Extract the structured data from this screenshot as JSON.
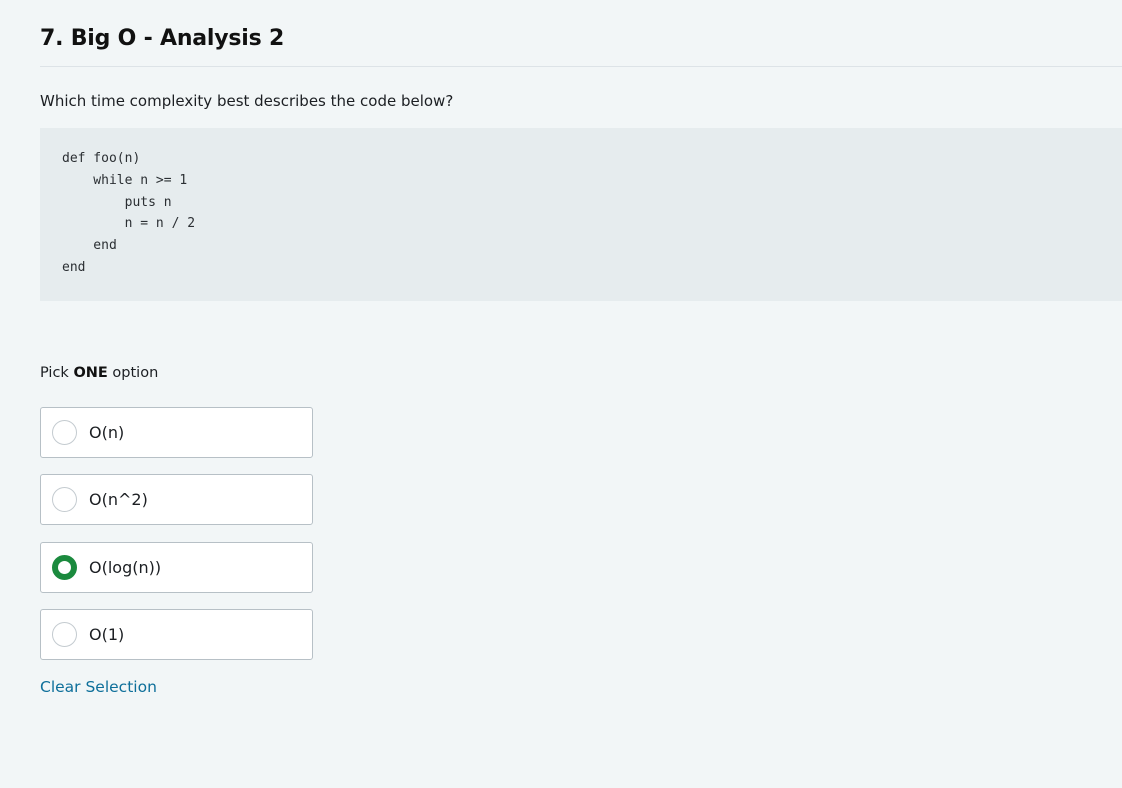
{
  "question": {
    "title": "7. Big O - Analysis 2",
    "prompt": "Which time complexity best describes the code below?"
  },
  "code": {
    "lines": [
      "def foo(n)",
      "    while n >= 1",
      "        puts n",
      "        n = n / 2",
      "    end",
      "end"
    ]
  },
  "pick": {
    "prefix": "Pick ",
    "emphasis": "ONE",
    "suffix": " option"
  },
  "options": [
    {
      "label": "O(n)",
      "selected": false
    },
    {
      "label": "O(n^2)",
      "selected": false
    },
    {
      "label": "O(log(n))",
      "selected": true
    },
    {
      "label": "O(1)",
      "selected": false
    }
  ],
  "actions": {
    "clear_label": "Clear Selection"
  },
  "colors": {
    "background": "#f2f6f7",
    "code_background": "#e6ecee",
    "selected_radio": "#1b8a3e",
    "link": "#0e6f9a"
  }
}
